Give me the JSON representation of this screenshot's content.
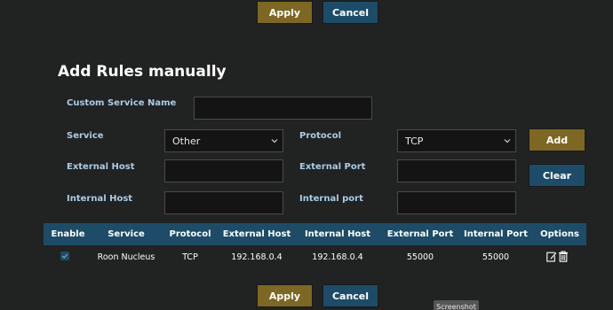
{
  "top_actions": {
    "apply_label": "Apply",
    "cancel_label": "Cancel"
  },
  "bottom_actions": {
    "apply_label": "Apply",
    "cancel_label": "Cancel"
  },
  "form": {
    "title": "Add Rules manually",
    "custom_service_name_label": "Custom Service Name",
    "custom_service_name_value": "",
    "service_label": "Service",
    "service_value": "Other",
    "protocol_label": "Protocol",
    "protocol_value": "TCP",
    "external_host_label": "External Host",
    "external_host_value": "",
    "external_port_label": "External Port",
    "external_port_value": "",
    "internal_host_label": "Internal Host",
    "internal_host_value": "",
    "internal_port_label": "Internal port",
    "internal_port_value": "",
    "add_label": "Add",
    "clear_label": "Clear"
  },
  "table": {
    "columns": [
      "Enable",
      "Service",
      "Protocol",
      "External Host",
      "Internal Host",
      "External Port",
      "Internal Port",
      "Options"
    ],
    "rows": [
      {
        "enabled": true,
        "service": "Roon Nucleus",
        "protocol": "TCP",
        "external_host": "192.168.0.4",
        "internal_host": "192.168.0.4",
        "external_port": "55000",
        "internal_port": "55000",
        "options": [
          "edit-icon",
          "trash-icon"
        ]
      }
    ]
  },
  "tooltip": {
    "text": "Screenshot"
  },
  "colors": {
    "background": "#212222",
    "apply_gold": "#7e6722",
    "cancel_blue": "#1c4c67",
    "label_blue": "#a9cde6",
    "field_bg": "#141414"
  }
}
